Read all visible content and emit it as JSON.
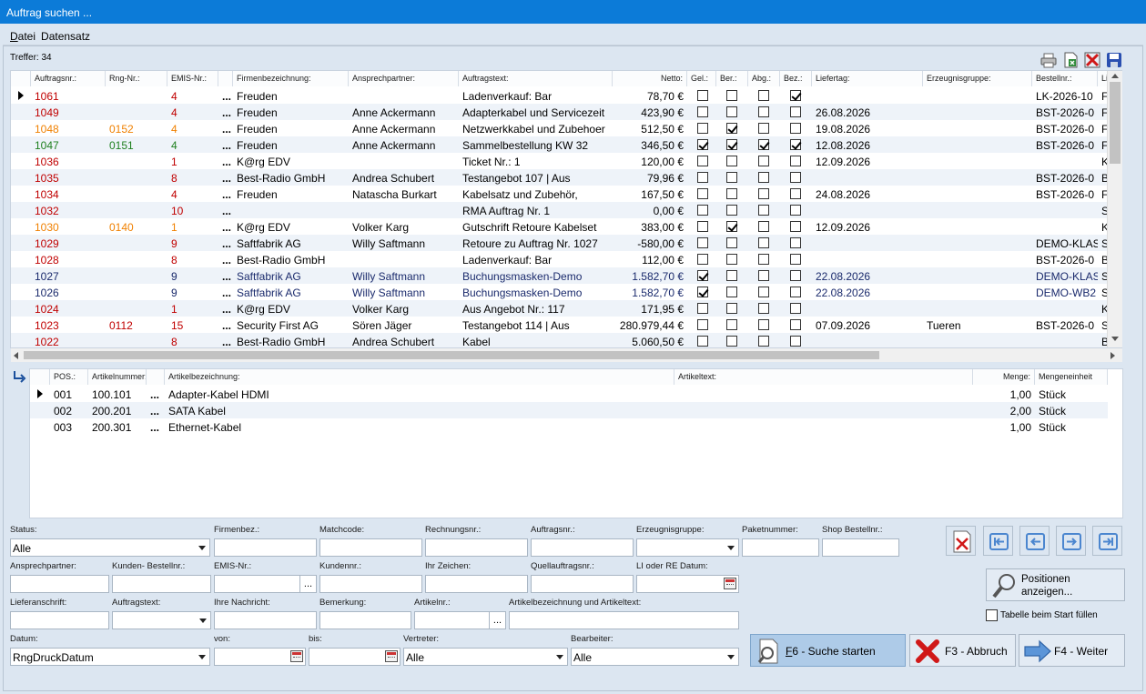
{
  "window": {
    "title": "Auftrag suchen ..."
  },
  "menu": {
    "datei": "Datei",
    "datensatz": "Datensatz"
  },
  "treffer": "Treffer: 34",
  "grid1": {
    "columns": [
      "Auftragsnr.:",
      "Rng-Nr.:",
      "EMIS-Nr.:",
      "Firmenbezeichnung:",
      "Ansprechpartner:",
      "Auftragstext:",
      "Netto:",
      "Gel.:",
      "Ber.:",
      "Abg.:",
      "Bez.:",
      "Liefertag:",
      "Erzeugnisgruppe:",
      "Bestellnr.:",
      "Li"
    ],
    "rows": [
      {
        "nr": "1061",
        "rng": "",
        "emis": "4",
        "firma": "Freuden",
        "ansp": "",
        "text": "Ladenverkauf: Bar",
        "netto": "78,70 €",
        "gel": false,
        "ber": false,
        "abg": false,
        "bez": true,
        "liefer": "",
        "gruppe": "",
        "bestell": "LK-2026-10",
        "li": "Fr",
        "color": "red",
        "selected": true
      },
      {
        "nr": "1049",
        "rng": "",
        "emis": "4",
        "firma": "Freuden",
        "ansp": "Anne Ackermann",
        "text": "Adapterkabel und Servicezeit",
        "netto": "423,90 €",
        "gel": false,
        "ber": false,
        "abg": false,
        "bez": false,
        "liefer": "26.08.2026",
        "gruppe": "",
        "bestell": "BST-2026-0",
        "li": "Fr",
        "color": "red"
      },
      {
        "nr": "1048",
        "rng": "0152",
        "emis": "4",
        "firma": "Freuden",
        "ansp": "Anne Ackermann",
        "text": "Netzwerkkabel und Zubehoer",
        "netto": "512,50 €",
        "gel": false,
        "ber": true,
        "abg": false,
        "bez": false,
        "liefer": "19.08.2026",
        "gruppe": "",
        "bestell": "BST-2026-0",
        "li": "Fr",
        "color": "orange"
      },
      {
        "nr": "1047",
        "rng": "0151",
        "emis": "4",
        "firma": "Freuden",
        "ansp": "Anne Ackermann",
        "text": "Sammelbestellung KW 32",
        "netto": "346,50 €",
        "gel": true,
        "ber": true,
        "abg": true,
        "bez": true,
        "liefer": "12.08.2026",
        "gruppe": "",
        "bestell": "BST-2026-0",
        "li": "Fr",
        "color": "green"
      },
      {
        "nr": "1036",
        "rng": "",
        "emis": "1",
        "firma": "K@rg EDV",
        "ansp": "",
        "text": "Ticket Nr.: 1",
        "netto": "120,00 €",
        "gel": false,
        "ber": false,
        "abg": false,
        "bez": false,
        "liefer": "12.09.2026",
        "gruppe": "",
        "bestell": "",
        "li": "K",
        "color": "red"
      },
      {
        "nr": "1035",
        "rng": "",
        "emis": "8",
        "firma": "Best-Radio GmbH",
        "ansp": "Andrea Schubert",
        "text": "Testangebot 107 | Aus",
        "netto": "79,96 €",
        "gel": false,
        "ber": false,
        "abg": false,
        "bez": false,
        "liefer": "",
        "gruppe": "",
        "bestell": "BST-2026-0",
        "li": "Be",
        "color": "red"
      },
      {
        "nr": "1034",
        "rng": "",
        "emis": "4",
        "firma": "Freuden",
        "ansp": "Natascha Burkart",
        "text": "Kabelsatz und Zubehör,",
        "netto": "167,50 €",
        "gel": false,
        "ber": false,
        "abg": false,
        "bez": false,
        "liefer": "24.08.2026",
        "gruppe": "",
        "bestell": "BST-2026-0",
        "li": "Fr",
        "color": "red"
      },
      {
        "nr": "1032",
        "rng": "",
        "emis": "10",
        "firma": "",
        "ansp": "",
        "text": "RMA Auftrag Nr. 1",
        "netto": "0,00 €",
        "gel": false,
        "ber": false,
        "abg": false,
        "bez": false,
        "liefer": "",
        "gruppe": "",
        "bestell": "",
        "li": "Sp",
        "color": "red"
      },
      {
        "nr": "1030",
        "rng": "0140",
        "emis": "1",
        "firma": "K@rg EDV",
        "ansp": "Volker Karg",
        "text": "Gutschrift Retoure Kabelset",
        "netto": "383,00 €",
        "gel": false,
        "ber": true,
        "abg": false,
        "bez": false,
        "liefer": "12.09.2026",
        "gruppe": "",
        "bestell": "",
        "li": "K",
        "color": "orange"
      },
      {
        "nr": "1029",
        "rng": "",
        "emis": "9",
        "firma": "Saftfabrik AG",
        "ansp": "Willy Saftmann",
        "text": "Retoure zu Auftrag Nr. 1027",
        "netto": "-580,00 €",
        "gel": false,
        "ber": false,
        "abg": false,
        "bez": false,
        "liefer": "",
        "gruppe": "",
        "bestell": "DEMO-KLAS",
        "li": "Sa",
        "color": "red"
      },
      {
        "nr": "1028",
        "rng": "",
        "emis": "8",
        "firma": "Best-Radio GmbH",
        "ansp": "",
        "text": "Ladenverkauf: Bar",
        "netto": "112,00 €",
        "gel": false,
        "ber": false,
        "abg": false,
        "bez": false,
        "liefer": "",
        "gruppe": "",
        "bestell": "BST-2026-0",
        "li": "Be",
        "color": "red"
      },
      {
        "nr": "1027",
        "rng": "",
        "emis": "9",
        "firma": "Saftfabrik AG",
        "ansp": "Willy Saftmann",
        "text": "Buchungsmasken-Demo",
        "netto": "1.582,70 €",
        "gel": true,
        "ber": false,
        "abg": false,
        "bez": false,
        "liefer": "22.08.2026",
        "gruppe": "",
        "bestell": "DEMO-KLAS",
        "li": "Sa",
        "color": "navy"
      },
      {
        "nr": "1026",
        "rng": "",
        "emis": "9",
        "firma": "Saftfabrik AG",
        "ansp": "Willy Saftmann",
        "text": "Buchungsmasken-Demo",
        "netto": "1.582,70 €",
        "gel": true,
        "ber": false,
        "abg": false,
        "bez": false,
        "liefer": "22.08.2026",
        "gruppe": "",
        "bestell": "DEMO-WB2",
        "li": "Sa",
        "color": "navy"
      },
      {
        "nr": "1024",
        "rng": "",
        "emis": "1",
        "firma": "K@rg EDV",
        "ansp": "Volker Karg",
        "text": "Aus Angebot Nr.: 117",
        "netto": "171,95 €",
        "gel": false,
        "ber": false,
        "abg": false,
        "bez": false,
        "liefer": "",
        "gruppe": "",
        "bestell": "",
        "li": "K",
        "color": "red"
      },
      {
        "nr": "1023",
        "rng": "0112",
        "emis": "15",
        "firma": "Security First AG",
        "ansp": "Sören Jäger",
        "text": "Testangebot 114 | Aus",
        "netto": "280.979,44 €",
        "gel": false,
        "ber": false,
        "abg": false,
        "bez": false,
        "liefer": "07.09.2026",
        "gruppe": "Tueren",
        "bestell": "BST-2026-0",
        "li": "Se",
        "color": "red"
      },
      {
        "nr": "1022",
        "rng": "",
        "emis": "8",
        "firma": "Best-Radio GmbH",
        "ansp": "Andrea Schubert",
        "text": "Kabel",
        "netto": "5.060,50 €",
        "gel": false,
        "ber": false,
        "abg": false,
        "bez": false,
        "liefer": "",
        "gruppe": "",
        "bestell": "",
        "li": "Be",
        "color": "red"
      }
    ]
  },
  "grid2": {
    "columns": [
      "POS.:",
      "Artikelnummer:",
      "Artikelbezeichnung:",
      "Artikeltext:",
      "Menge:",
      "Mengeneinheit"
    ],
    "rows": [
      {
        "pos": "001",
        "art": "100.101",
        "bez": "Adapter-Kabel HDMI",
        "text": "",
        "menge": "1,00",
        "einheit": "Stück"
      },
      {
        "pos": "002",
        "art": "200.201",
        "bez": "SATA Kabel",
        "text": "",
        "menge": "2,00",
        "einheit": "Stück"
      },
      {
        "pos": "003",
        "art": "200.301",
        "bez": "Ethernet-Kabel",
        "text": "",
        "menge": "1,00",
        "einheit": "Stück"
      }
    ]
  },
  "dots": "...",
  "filters": {
    "status_label": "Status:",
    "status_value": "Alle",
    "firmenbez_label": "Firmenbez.:",
    "matchcode_label": "Matchcode:",
    "rechnungsnr_label": "Rechnungsnr.:",
    "auftragsnr_label": "Auftragsnr.:",
    "erzeugnisgruppe_label": "Erzeugnisgruppe:",
    "paketnummer_label": "Paketnummer:",
    "shopbestellnr_label": "Shop Bestellnr.:",
    "ansprechpartner_label": "Ansprechpartner:",
    "kundenbestellnr_label": "Kunden- Bestellnr.:",
    "emisnr_label": "EMIS-Nr.:",
    "kundennr_label": "Kundennr.:",
    "ihrzeichen_label": "Ihr Zeichen:",
    "quellauftragsnr_label": "Quellauftragsnr.:",
    "lidatum_label": "LI oder RE Datum:",
    "lieferanschrift_label": "Lieferanschrift:",
    "auftragstext_label": "Auftragstext:",
    "ihrenachricht_label": "Ihre Nachricht:",
    "bemerkung_label": "Bemerkung:",
    "artikelnr_label": "Artikelnr.:",
    "artikelbez_label": "Artikelbezeichnung und Artikeltext:",
    "datum_label": "Datum:",
    "datum_value": "RngDruckDatum",
    "von_label": "von:",
    "bis_label": "bis:",
    "vertreter_label": "Vertreter:",
    "vertreter_value": "Alle",
    "bearbeiter_label": "Bearbeiter:",
    "bearbeiter_value": "Alle"
  },
  "buttons": {
    "positionen": "Positionen anzeigen...",
    "tabelle_fuellen": "Tabelle beim Start füllen",
    "suche": "F6 - Suche starten",
    "abbruch": "F3 - Abbruch",
    "weiter": "F4 - Weiter"
  },
  "colors": {
    "titlebar": "#0c7bd8",
    "red": "#c00000",
    "orange": "#f08000",
    "green": "#208020",
    "navy": "#1a2a6c",
    "accent_button": "#aecbe8"
  }
}
